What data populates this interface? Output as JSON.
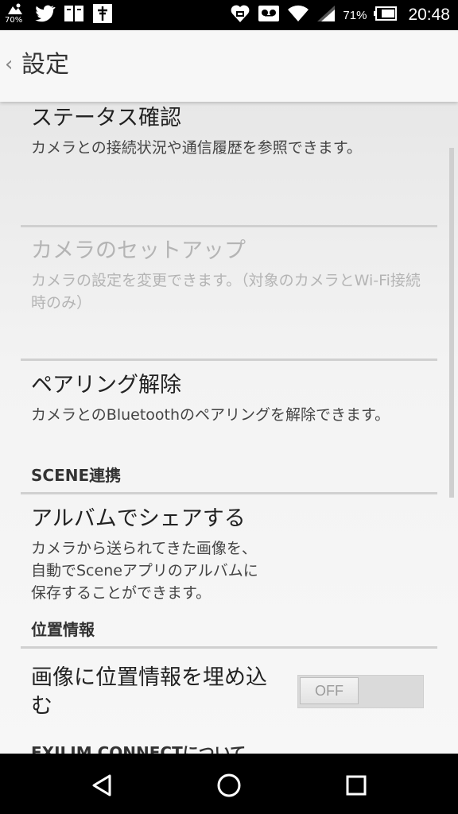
{
  "status_bar": {
    "small_battery_percent": "70%",
    "battery_percent": "71%",
    "time": "20:48",
    "icons": [
      "notification-icon",
      "twitter-icon",
      "book-icon",
      "app-icon",
      "heart-icon",
      "voicemail-icon",
      "wifi-icon",
      "signal-icon",
      "battery-icon"
    ]
  },
  "action_bar": {
    "back": "‹",
    "title": "設定"
  },
  "items": {
    "status": {
      "title": "ステータス確認",
      "summary": "カメラとの接続状況や通信履歴を参照できます。"
    },
    "camera_setup": {
      "title": "カメラのセットアップ",
      "summary": "カメラの設定を変更できます。（対象のカメラとWi-Fi接続時のみ）"
    },
    "unpair": {
      "title": "ペアリング解除",
      "summary": "カメラとのBluetoothのペアリングを解除できます。"
    },
    "album_share": {
      "title": "アルバムでシェアする",
      "summary_line1": "カメラから送られてきた画像を、",
      "summary_line2": "自動でSceneアプリのアルバムに",
      "summary_line3": "保存することができます。"
    },
    "geotag": {
      "title_line1": "画像に位置情報を埋め込",
      "title_line2": "む",
      "toggle_label": "OFF",
      "toggle_state": "off"
    }
  },
  "sections": {
    "scene": "SCENE連携",
    "location": "位置情報",
    "about": "EXILIM CONNECTについて"
  },
  "colors": {
    "status_bar": "#000000",
    "action_bar": "#f7f7f7",
    "divider": "#d0d0d0",
    "disabled_text": "#b4b4b4"
  },
  "nav_bar": {
    "buttons": [
      "back-triangle-icon",
      "home-circle-icon",
      "recents-square-icon"
    ]
  }
}
